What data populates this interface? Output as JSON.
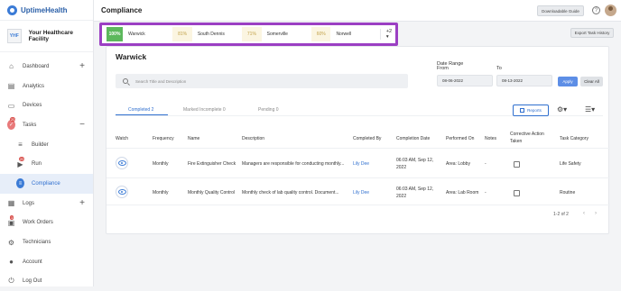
{
  "brand": {
    "name": "UptimeHealth"
  },
  "facility": {
    "logo_text": "YHF",
    "name": "Your Healthcare Facility"
  },
  "nav": {
    "dashboard": "Dashboard",
    "analytics": "Analytics",
    "devices": "Devices",
    "tasks": "Tasks",
    "tasks_badge": "20",
    "builder": "Builder",
    "run": "Run",
    "run_badge": "20",
    "compliance": "Compliance",
    "logs": "Logs",
    "work_orders": "Work Orders",
    "work_orders_badge": "1",
    "technicians": "Technicians",
    "account": "Account",
    "logout": "Log Out"
  },
  "header": {
    "title": "Compliance",
    "guide_button": "Downloadable Guide",
    "help": "?"
  },
  "facility_tabs": [
    {
      "pct": "100%",
      "name": "Warwick"
    },
    {
      "pct": "81%",
      "name": "South Dennis"
    },
    {
      "pct": "71%",
      "name": "Somerville"
    },
    {
      "pct": "60%",
      "name": "Norwell"
    }
  ],
  "facility_tabs_more": "+2 ▾",
  "export_button": "Export Task History",
  "card": {
    "title": "Warwick",
    "search_placeholder": "Search Title and Description",
    "date_range_label": "Date Range",
    "from_label": "From",
    "to_label": "To",
    "from_value": "08-06-2022",
    "to_value": "08-13-2022",
    "apply": "Apply",
    "clear_all": "Clear All"
  },
  "subtabs": [
    "Completed 2",
    "Marked Incomplete 0",
    "Pending 0"
  ],
  "reports_button": "Reports",
  "columns": [
    "Watch",
    "Frequency",
    "Name",
    "Description",
    "Completed By",
    "Completion Date",
    "Performed On",
    "Notes",
    "Corrective Action Taken",
    "Task Category"
  ],
  "rows": [
    {
      "frequency": "Monthly",
      "name": "Fire Extinguisher Check",
      "description": "Managers are responsible for conducting monthly...",
      "completed_by": "Lily Dee",
      "date_line1": "06:03 AM, Sep 12,",
      "date_line2": "2022",
      "performed_on": "Area: Lobby",
      "notes": "-",
      "category": "Life Safety"
    },
    {
      "frequency": "Monthly",
      "name": "Monthly Quality Control",
      "description": "Monthly check of lab quality control. Document...",
      "completed_by": "Lily Dee",
      "date_line1": "06:03 AM, Sep 12,",
      "date_line2": "2022",
      "performed_on": "Area: Lab Room",
      "notes": "-",
      "category": "Routine"
    }
  ],
  "pager": {
    "text": "1-2 of 2",
    "prev": "‹",
    "next": "›"
  },
  "colors": {
    "accent": "#2f6fcf",
    "highlight_border": "#9b3fc3",
    "success": "#5cb85c",
    "badge": "#d9534f"
  }
}
